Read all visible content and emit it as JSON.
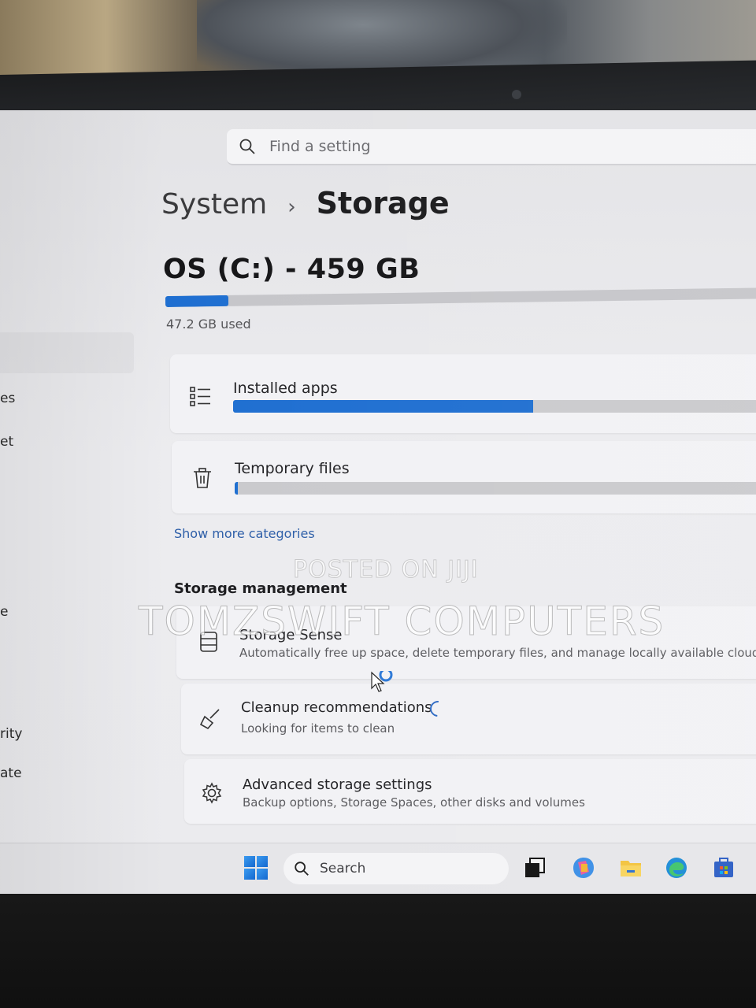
{
  "search": {
    "placeholder": "Find a setting"
  },
  "breadcrumb": {
    "parent": "System",
    "separator": "›",
    "current": "Storage"
  },
  "drive": {
    "title": "OS (C:) - 459 GB",
    "used_label": "47.2 GB used",
    "used_fraction": 0.103
  },
  "sidebar_fragments": [
    "es",
    "et",
    "e",
    "rity",
    "ate"
  ],
  "categories": [
    {
      "label": "Installed apps",
      "icon": "list-icon",
      "fraction": 0.56
    },
    {
      "label": "Temporary files",
      "icon": "trash-icon",
      "fraction": 0.006
    }
  ],
  "show_more": "Show more categories",
  "storage_management": {
    "heading": "Storage management",
    "items": [
      {
        "title": "Storage Sense",
        "desc": "Automatically free up space, delete temporary files, and manage locally available cloud c",
        "icon": "drive-icon"
      },
      {
        "title": "Cleanup recommendations",
        "desc": "Looking for items to clean",
        "icon": "broom-icon"
      },
      {
        "title": "Advanced storage settings",
        "desc": "Backup options, Storage Spaces, other disks and volumes",
        "icon": "gear-icon"
      }
    ]
  },
  "taskbar": {
    "search_label": "Search"
  },
  "watermarks": {
    "line1": "POSTED ON JIJI",
    "line2": "TOMZSWIFT COMPUTERS"
  },
  "colors": {
    "accent": "#1f6fd1",
    "link": "#2d5ea8",
    "bar_track": "#c6c6ca"
  }
}
